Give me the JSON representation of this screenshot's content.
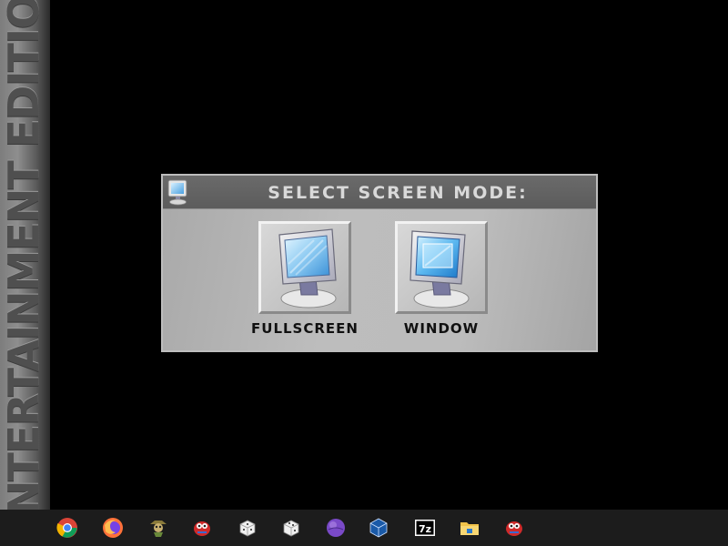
{
  "side_banner": {
    "text": "NTERTAINMENT EDITION"
  },
  "dialog": {
    "title": "SELECT SCREEN MODE:",
    "options": [
      {
        "label": "FULLSCREEN",
        "icon": "monitor-fullscreen-icon"
      },
      {
        "label": "WINDOW",
        "icon": "monitor-window-icon"
      }
    ]
  },
  "taskbar": {
    "icons": [
      "chrome-icon",
      "firefox-icon",
      "game-character-icon",
      "red-creature-icon",
      "dice-icon",
      "dice-icon",
      "purple-orb-icon",
      "virtualbox-icon",
      "7zip-icon",
      "file-explorer-icon",
      "red-creature-icon"
    ]
  },
  "colors": {
    "background": "#000000",
    "dialog_body": "#bdbdbd",
    "title_bar": "#5f5f5f",
    "title_text": "#d9d9d9",
    "taskbar": "#1c1c1c"
  }
}
